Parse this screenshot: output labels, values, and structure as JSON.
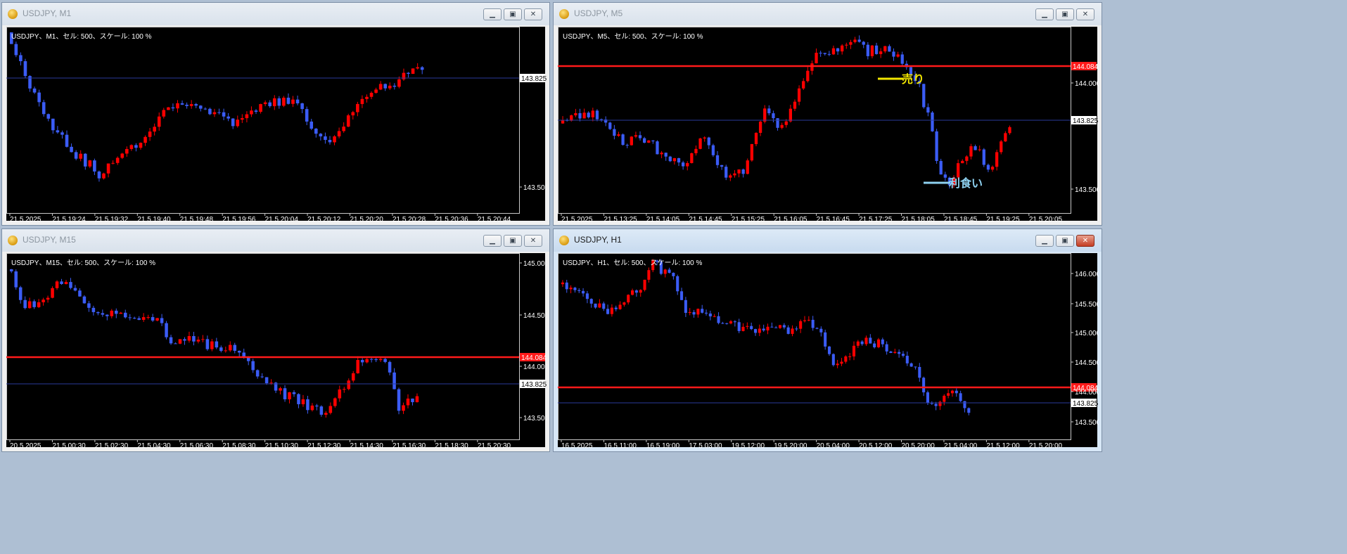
{
  "windows": [
    {
      "id": "m1",
      "title": "USDJPY, M1",
      "info": "USDJPY、M1、セル: 500、スケール: 100 %",
      "active": false,
      "price_levels": [
        {
          "value": "143.825",
          "kind": "bid"
        },
        {
          "value": "143.500",
          "kind": "tick"
        }
      ],
      "time_labels": [
        "21 5 2025",
        "21 5 19:24",
        "21 5 19:32",
        "21 5 19:40",
        "21 5 19:48",
        "21 5 19:56",
        "21 5 20:04",
        "21 5 20:12",
        "21 5 20:20",
        "21 5 20:28",
        "21 5 20:36",
        "21 5 20:44"
      ],
      "annotations": []
    },
    {
      "id": "m5",
      "title": "USDJPY, M5",
      "info": "USDJPY、M5、セル: 500、スケール: 100 %",
      "active": false,
      "price_levels": [
        {
          "value": "144.084",
          "kind": "red"
        },
        {
          "value": "144.000",
          "kind": "tick"
        },
        {
          "value": "143.825",
          "kind": "bid"
        },
        {
          "value": "143.500",
          "kind": "tick"
        }
      ],
      "time_labels": [
        "21 5 2025",
        "21 5 13:25",
        "21 5 14:05",
        "21 5 14:45",
        "21 5 15:25",
        "21 5 16:05",
        "21 5 16:45",
        "21 5 17:25",
        "21 5 18:05",
        "21 5 18:45",
        "21 5 19:25",
        "21 5 20:05"
      ],
      "annotations": [
        {
          "text": "売り",
          "color": "#f2e600"
        },
        {
          "text": "利食い",
          "color": "#8ed1f0"
        }
      ]
    },
    {
      "id": "m15",
      "title": "USDJPY, M15",
      "info": "USDJPY、M15、セル: 500、スケール: 100 %",
      "active": false,
      "price_levels": [
        {
          "value": "145.000",
          "kind": "tick"
        },
        {
          "value": "144.500",
          "kind": "tick"
        },
        {
          "value": "144.084",
          "kind": "red"
        },
        {
          "value": "144.000",
          "kind": "tick"
        },
        {
          "value": "143.825",
          "kind": "bid"
        },
        {
          "value": "143.500",
          "kind": "tick"
        }
      ],
      "time_labels": [
        "20 5 2025",
        "21 5 00:30",
        "21 5 02:30",
        "21 5 04:30",
        "21 5 06:30",
        "21 5 08:30",
        "21 5 10:30",
        "21 5 12:30",
        "21 5 14:30",
        "21 5 16:30",
        "21 5 18:30",
        "21 5 20:30"
      ],
      "annotations": []
    },
    {
      "id": "h1",
      "title": "USDJPY, H1",
      "info": "USDJPY、H1、セル: 500、スケール: 100 %",
      "active": true,
      "price_levels": [
        {
          "value": "146.000",
          "kind": "tick"
        },
        {
          "value": "145.500",
          "kind": "tick"
        },
        {
          "value": "145.000",
          "kind": "tick"
        },
        {
          "value": "144.500",
          "kind": "tick"
        },
        {
          "value": "144.084",
          "kind": "red"
        },
        {
          "value": "144.000",
          "kind": "tick"
        },
        {
          "value": "143.825",
          "kind": "bid"
        },
        {
          "value": "143.500",
          "kind": "tick"
        }
      ],
      "time_labels": [
        "16 5 2025",
        "16 5 11:00",
        "16 5 19:00",
        "17 5 03:00",
        "19 5 12:00",
        "19 5 20:00",
        "20 5 04:00",
        "20 5 12:00",
        "20 5 20:00",
        "21 5 04:00",
        "21 5 12:00",
        "21 5 20:00"
      ],
      "annotations": []
    }
  ],
  "colors": {
    "bull": "#ff0000",
    "bear": "#3b5cf5",
    "red_line": "#ff1a1a",
    "bid_line": "#2a3a9a",
    "grid_text": "#ffffff"
  }
}
